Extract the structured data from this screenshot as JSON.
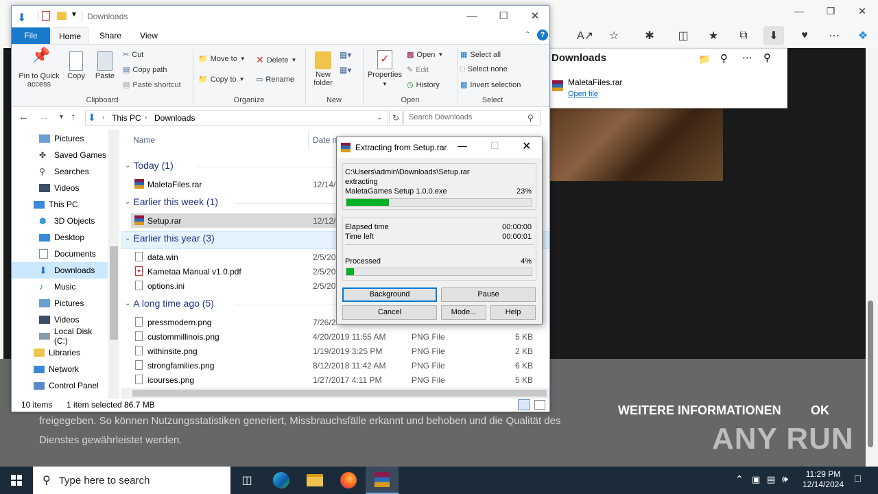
{
  "explorer": {
    "title": "Downloads",
    "tabs": {
      "file": "File",
      "home": "Home",
      "share": "Share",
      "view": "View"
    },
    "ribbon": {
      "pin_quick_access": "Pin to Quick access",
      "copy": "Copy",
      "paste": "Paste",
      "cut": "Cut",
      "copy_path": "Copy path",
      "paste_shortcut": "Paste shortcut",
      "clipboard": "Clipboard",
      "move_to": "Move to",
      "copy_to": "Copy to",
      "delete": "Delete",
      "rename": "Rename",
      "organize": "Organize",
      "new_folder": "New folder",
      "new": "New",
      "properties": "Properties",
      "open": "Open",
      "edit": "Edit",
      "history": "History",
      "open_group": "Open",
      "select_all": "Select all",
      "select_none": "Select none",
      "invert_selection": "Invert selection",
      "select_group": "Select"
    },
    "address": {
      "this_pc": "This PC",
      "downloads": "Downloads"
    },
    "search_placeholder": "Search Downloads",
    "nav": [
      "Pictures",
      "Saved Games",
      "Searches",
      "Videos",
      "This PC",
      "3D Objects",
      "Desktop",
      "Documents",
      "Downloads",
      "Music",
      "Pictures",
      "Videos",
      "Local Disk (C:)",
      "Libraries",
      "Network",
      "Control Panel"
    ],
    "columns": {
      "name": "Name",
      "date": "Date m"
    },
    "groups": {
      "today": "Today (1)",
      "week": "Earlier this week (1)",
      "year": "Earlier this year (3)",
      "longago": "A long time ago (5)"
    },
    "files": {
      "today": [
        {
          "name": "MaletaFiles.rar",
          "date": "12/14/"
        }
      ],
      "week": [
        {
          "name": "Setup.rar",
          "date": "12/12/"
        }
      ],
      "year": [
        {
          "name": "data.win",
          "date": "2/5/20"
        },
        {
          "name": "Kametaa Manual v1.0.pdf",
          "date": "2/5/20"
        },
        {
          "name": "options.ini",
          "date": "2/5/20"
        }
      ],
      "longago": [
        {
          "name": "pressmodern.png",
          "date": "7/26/2",
          "type": "",
          "size": ""
        },
        {
          "name": "custommillinois.png",
          "date": "4/20/2019 11:55 AM",
          "type": "PNG File",
          "size": "5 KB"
        },
        {
          "name": "withinsite.png",
          "date": "1/19/2019 3:25 PM",
          "type": "PNG File",
          "size": "2 KB"
        },
        {
          "name": "strongfamilies.png",
          "date": "8/12/2018 11:42 AM",
          "type": "PNG File",
          "size": "6 KB"
        },
        {
          "name": "icourses.png",
          "date": "1/27/2017 4:11 PM",
          "type": "PNG File",
          "size": "5 KB"
        }
      ]
    },
    "status": {
      "count": "10 items",
      "selected": "1 item selected",
      "size": "86.7 MB"
    }
  },
  "winrar": {
    "title": "Extracting from Setup.rar",
    "archive_path": "C:\\Users\\admin\\Downloads\\Setup.rar",
    "action": "extracting",
    "current_file": "MaletaGames Setup 1.0.0.exe",
    "file_percent_label": "23%",
    "file_progress": 0.23,
    "elapsed_label": "Elapsed time",
    "elapsed": "00:00:00",
    "left_label": "Time left",
    "left": "00:00:01",
    "processed_label": "Processed",
    "processed_percent_label": "4%",
    "processed_progress": 0.04,
    "buttons": {
      "background": "Background",
      "pause": "Pause",
      "cancel": "Cancel",
      "mode": "Mode...",
      "help": "Help"
    }
  },
  "edge": {
    "downloads_title": "Downloads",
    "download_file": "MaletaFiles.rar",
    "open_file": "Open file",
    "cookie_text": "freigegeben. So können Nutzungsstatistiken generiert, Missbrauchsfälle erkannt und behoben und die Qualität des Dienstes gewährleistet werden.",
    "more_info": "WEITERE INFORMATIONEN",
    "ok": "OK",
    "watermark": "ANY RUN"
  },
  "taskbar": {
    "search_placeholder": "Type here to search",
    "time": "11:29 PM",
    "date": "12/14/2024"
  }
}
